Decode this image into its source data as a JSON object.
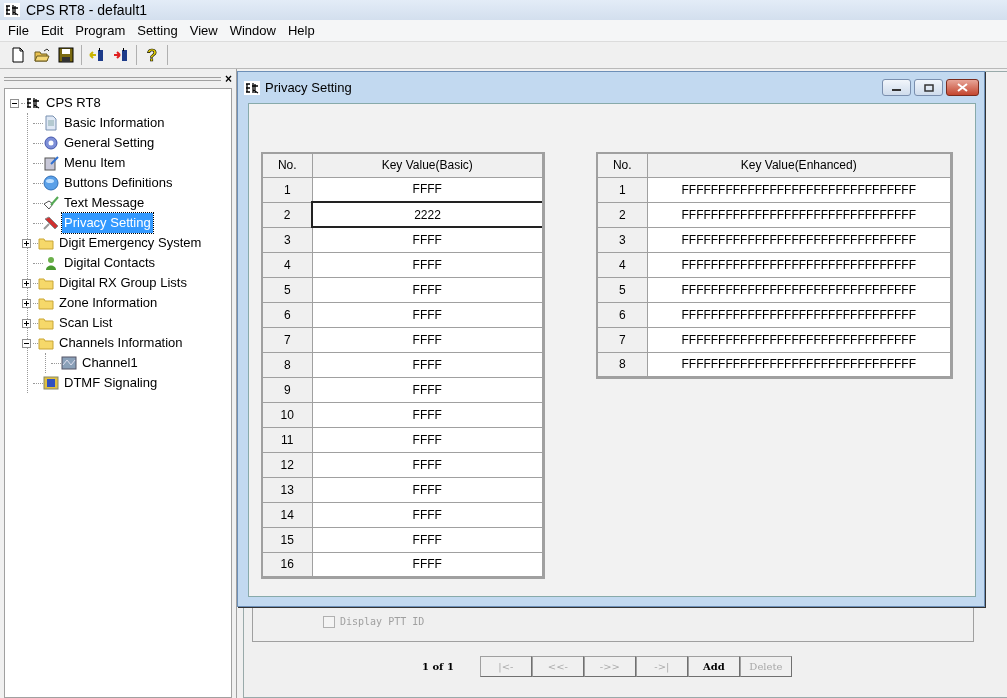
{
  "window": {
    "title": "CPS RT8 - default1"
  },
  "menu": [
    "File",
    "Edit",
    "Program",
    "Setting",
    "View",
    "Window",
    "Help"
  ],
  "toolbar": {
    "help_glyph": "?"
  },
  "left_pane": {
    "close_glyph": "×"
  },
  "tree": {
    "label": "CPS RT8",
    "expanded": true,
    "children": [
      {
        "label": "Basic Information",
        "kind": "document",
        "selected": false
      },
      {
        "label": "General Setting",
        "kind": "gear",
        "selected": false
      },
      {
        "label": "Menu Item",
        "kind": "menu",
        "selected": false
      },
      {
        "label": "Buttons Definitions",
        "kind": "globe",
        "selected": false
      },
      {
        "label": "Text Message",
        "kind": "message",
        "selected": false
      },
      {
        "label": "Privacy Setting",
        "kind": "tool",
        "selected": true
      },
      {
        "label": "Digit Emergency System",
        "kind": "folder",
        "selected": false,
        "expanded": false
      },
      {
        "label": "Digital Contacts",
        "kind": "contact",
        "selected": false
      },
      {
        "label": "Digital RX Group Lists",
        "kind": "folder",
        "selected": false,
        "expanded": false
      },
      {
        "label": "Zone Information",
        "kind": "folder",
        "selected": false,
        "expanded": false
      },
      {
        "label": "Scan List",
        "kind": "folder",
        "selected": false,
        "expanded": false
      },
      {
        "label": "Channels Information",
        "kind": "folder",
        "selected": false,
        "expanded": true,
        "children": [
          {
            "label": "Channel1",
            "kind": "channel",
            "selected": false
          }
        ]
      },
      {
        "label": "DTMF Signaling",
        "kind": "dtmf",
        "selected": false
      }
    ]
  },
  "privacy_window": {
    "title": "Privacy Setting",
    "basic_table": {
      "columns": [
        "No.",
        "Key Value(Basic)"
      ],
      "rows": [
        {
          "no": "1",
          "value": "FFFF",
          "selected": false
        },
        {
          "no": "2",
          "value": "2222",
          "selected": true
        },
        {
          "no": "3",
          "value": "FFFF",
          "selected": false
        },
        {
          "no": "4",
          "value": "FFFF",
          "selected": false
        },
        {
          "no": "5",
          "value": "FFFF",
          "selected": false
        },
        {
          "no": "6",
          "value": "FFFF",
          "selected": false
        },
        {
          "no": "7",
          "value": "FFFF",
          "selected": false
        },
        {
          "no": "8",
          "value": "FFFF",
          "selected": false
        },
        {
          "no": "9",
          "value": "FFFF",
          "selected": false
        },
        {
          "no": "10",
          "value": "FFFF",
          "selected": false
        },
        {
          "no": "11",
          "value": "FFFF",
          "selected": false
        },
        {
          "no": "12",
          "value": "FFFF",
          "selected": false
        },
        {
          "no": "13",
          "value": "FFFF",
          "selected": false
        },
        {
          "no": "14",
          "value": "FFFF",
          "selected": false
        },
        {
          "no": "15",
          "value": "FFFF",
          "selected": false
        },
        {
          "no": "16",
          "value": "FFFF",
          "selected": false
        }
      ]
    },
    "enhanced_table": {
      "columns": [
        "No.",
        "Key Value(Enhanced)"
      ],
      "rows": [
        {
          "no": "1",
          "value": "FFFFFFFFFFFFFFFFFFFFFFFFFFFFFFFF"
        },
        {
          "no": "2",
          "value": "FFFFFFFFFFFFFFFFFFFFFFFFFFFFFFFF"
        },
        {
          "no": "3",
          "value": "FFFFFFFFFFFFFFFFFFFFFFFFFFFFFFFF"
        },
        {
          "no": "4",
          "value": "FFFFFFFFFFFFFFFFFFFFFFFFFFFFFFFF"
        },
        {
          "no": "5",
          "value": "FFFFFFFFFFFFFFFFFFFFFFFFFFFFFFFF"
        },
        {
          "no": "6",
          "value": "FFFFFFFFFFFFFFFFFFFFFFFFFFFFFFFF"
        },
        {
          "no": "7",
          "value": "FFFFFFFFFFFFFFFFFFFFFFFFFFFFFFFF"
        },
        {
          "no": "8",
          "value": "FFFFFFFFFFFFFFFFFFFFFFFFFFFFFFFF"
        }
      ]
    }
  },
  "channel_window": {
    "checkbox": {
      "label": "Display PTT ID",
      "checked": false,
      "disabled": true
    },
    "pager": {
      "text": "1 of 1",
      "buttons": [
        {
          "label": "|<-",
          "disabled": true
        },
        {
          "label": "<<-",
          "disabled": true
        },
        {
          "label": "->>",
          "disabled": true
        },
        {
          "label": "->|",
          "disabled": true
        },
        {
          "label": "Add",
          "disabled": false
        },
        {
          "label": "Delete",
          "disabled": true
        }
      ]
    }
  }
}
